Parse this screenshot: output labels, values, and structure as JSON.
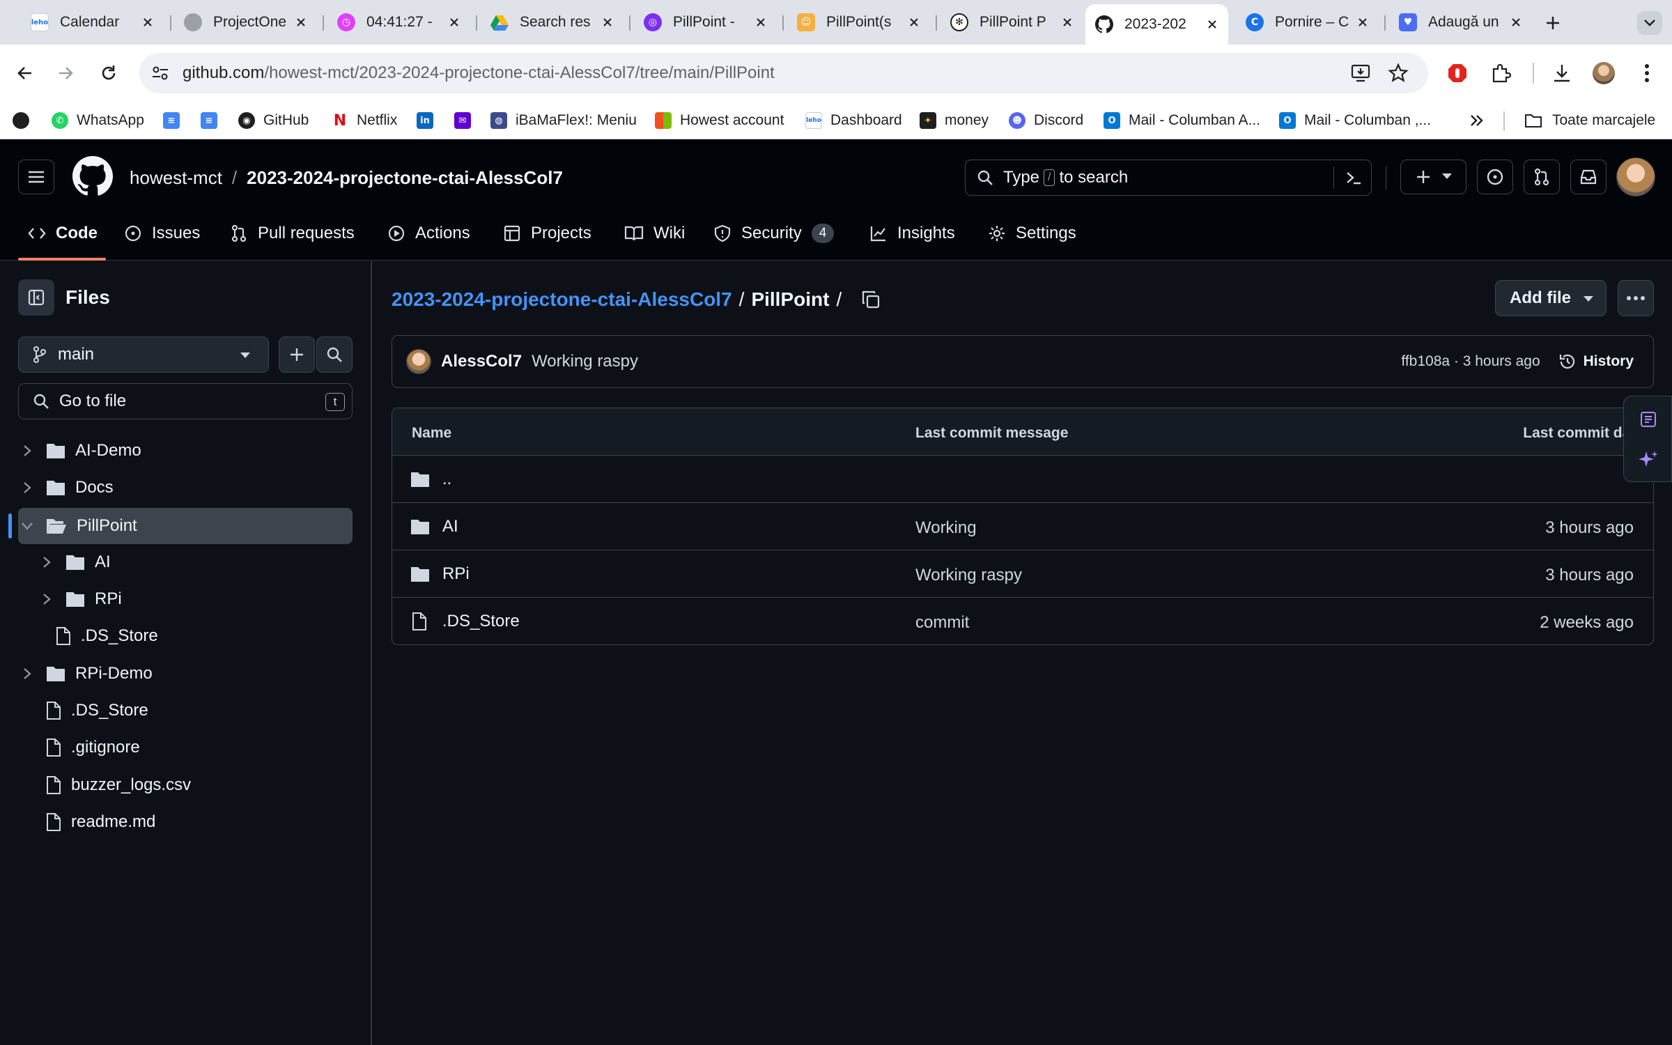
{
  "browser": {
    "tabs": [
      {
        "title": "Calendar",
        "icon": "leho-icon"
      },
      {
        "title": "ProjectOne",
        "icon": "globe-icon"
      },
      {
        "title": "04:41:27 -",
        "icon": "timer-icon"
      },
      {
        "title": "Search res",
        "icon": "drive-icon"
      },
      {
        "title": "PillPoint -",
        "icon": "app-icon"
      },
      {
        "title": "PillPoint(s",
        "icon": "avatar-icon"
      },
      {
        "title": "PillPoint P",
        "icon": "openai-icon"
      },
      {
        "title": "2023-202",
        "icon": "github-icon"
      },
      {
        "title": "Pornire – C",
        "icon": "canva-icon"
      },
      {
        "title": "Adaugă un",
        "icon": "heart-icon"
      }
    ],
    "active_tab_index": 7,
    "url_host": "github.com",
    "url_path": "/howest-mct/2023-2024-projectone-ctai-AlessCol7/tree/main/PillPoint",
    "bookmarks": [
      "WhatsApp",
      "",
      "",
      "GitHub",
      "Netflix",
      "",
      "",
      "iBaMaFlex!: Meniu",
      "Howest account",
      "Dashboard",
      "money",
      "Discord",
      "Mail - Columban A...",
      "Mail - Columban ,..."
    ],
    "all_bookmarks_label": "Toate marcajele"
  },
  "github": {
    "owner": "howest-mct",
    "repo": "2023-2024-projectone-ctai-AlessCol7",
    "search_prefix": "Type",
    "search_slash": "/",
    "search_suffix": "to search",
    "nav": [
      "Code",
      "Issues",
      "Pull requests",
      "Actions",
      "Projects",
      "Wiki",
      "Security",
      "Insights",
      "Settings"
    ],
    "security_count": "4"
  },
  "sidebar": {
    "title": "Files",
    "branch": "main",
    "goto_placeholder": "Go to file",
    "goto_shortcut": "t",
    "tree": [
      {
        "name": "AI-Demo",
        "type": "folder",
        "depth": 0,
        "expanded": false
      },
      {
        "name": "Docs",
        "type": "folder",
        "depth": 0,
        "expanded": false
      },
      {
        "name": "PillPoint",
        "type": "folder",
        "depth": 0,
        "expanded": true,
        "selected": true
      },
      {
        "name": "AI",
        "type": "folder",
        "depth": 1,
        "expanded": false
      },
      {
        "name": "RPi",
        "type": "folder",
        "depth": 1,
        "expanded": false
      },
      {
        "name": ".DS_Store",
        "type": "file",
        "depth": 1
      },
      {
        "name": "RPi-Demo",
        "type": "folder",
        "depth": 0,
        "expanded": false
      },
      {
        "name": ".DS_Store",
        "type": "file",
        "depth": 0
      },
      {
        "name": ".gitignore",
        "type": "file",
        "depth": 0
      },
      {
        "name": "buzzer_logs.csv",
        "type": "file",
        "depth": 0
      },
      {
        "name": "readme.md",
        "type": "file",
        "depth": 0
      }
    ]
  },
  "main": {
    "breadcrumb_repo": "2023-2024-projectone-ctai-AlessCol7",
    "breadcrumb_sep": "/",
    "breadcrumb_folder": "PillPoint",
    "breadcrumb_trail": "/",
    "add_file": "Add file",
    "commit": {
      "author": "AlessCol7",
      "message": "Working raspy",
      "sha_time": "ffb108a · 3 hours ago",
      "history": "History"
    },
    "table": {
      "headers": [
        "Name",
        "Last commit message",
        "Last commit date"
      ],
      "rows": [
        {
          "name": "..",
          "type": "folder",
          "message": "",
          "date": ""
        },
        {
          "name": "AI",
          "type": "folder",
          "message": "Working",
          "date": "3 hours ago"
        },
        {
          "name": "RPi",
          "type": "folder",
          "message": "Working raspy",
          "date": "3 hours ago"
        },
        {
          "name": ".DS_Store",
          "type": "file",
          "message": "commit",
          "date": "2 weeks ago"
        }
      ]
    }
  },
  "colors": {
    "accent_link": "#4493f8",
    "underline": "#f78166",
    "bg": "#0d1117"
  }
}
